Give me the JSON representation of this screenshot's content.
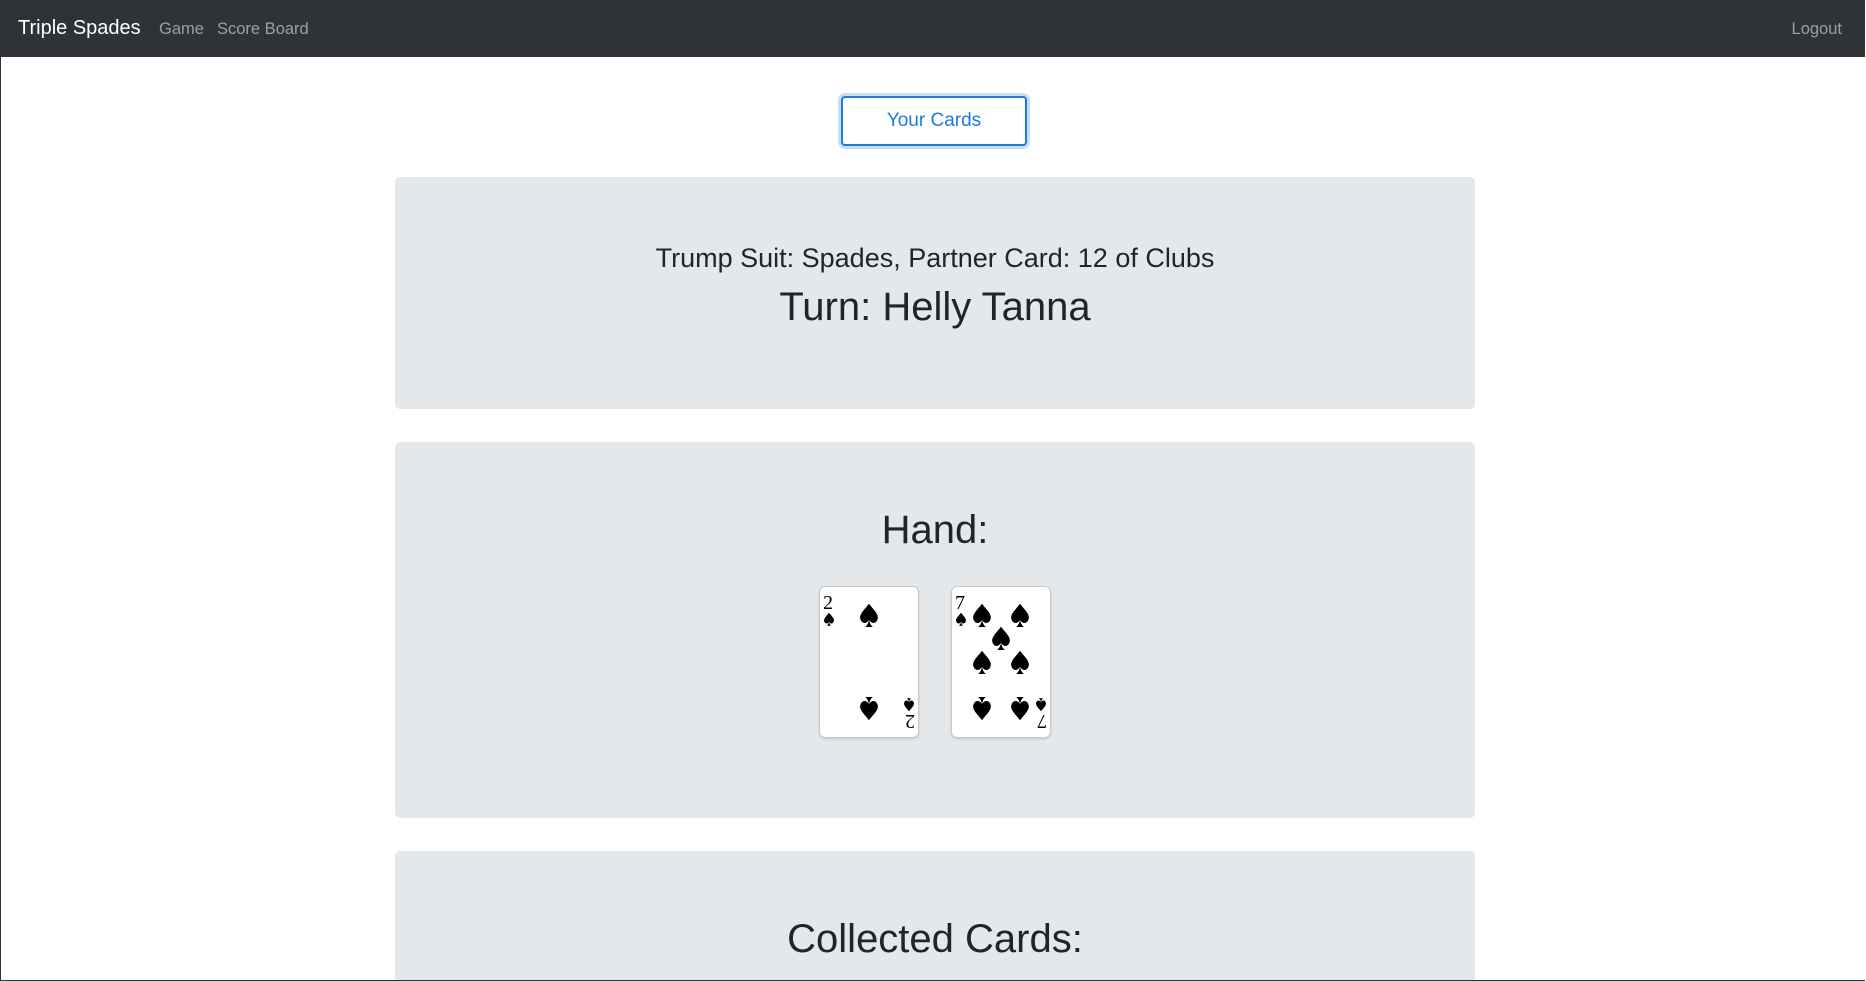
{
  "navbar": {
    "brand": "Triple Spades",
    "links": [
      "Game",
      "Score Board"
    ],
    "logout": "Logout"
  },
  "your_cards_button": "Your Cards",
  "info": {
    "trump_line": "Trump Suit: Spades, Partner Card: 12 of Clubs",
    "turn_line": "Turn: Helly Tanna"
  },
  "hand": {
    "title": "Hand:",
    "cards": [
      {
        "rank": "2",
        "suit": "Spades"
      },
      {
        "rank": "7",
        "suit": "Spades"
      }
    ]
  },
  "collected": {
    "title": "Collected Cards:"
  },
  "colors": {
    "navbar": "#2f3337",
    "panel": "#e5e8eb",
    "accent": "#1f7ae0"
  }
}
